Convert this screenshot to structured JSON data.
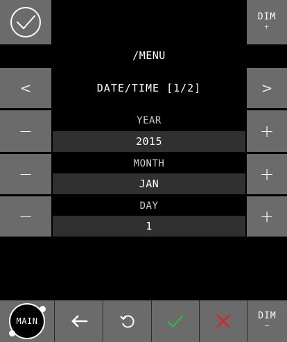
{
  "header": {
    "top_right": {
      "label": "DIM",
      "sign": "+"
    },
    "menu_path": "/MENU"
  },
  "nav": {
    "page_title": "DATE/TIME [1/2]",
    "prev_glyph": "<",
    "next_glyph": ">"
  },
  "fields": [
    {
      "label": "YEAR",
      "value": "2015"
    },
    {
      "label": "MONTH",
      "value": "JAN"
    },
    {
      "label": "DAY",
      "value": "1"
    }
  ],
  "steppers": {
    "minus": "−",
    "plus": "+"
  },
  "bottom_bar": {
    "main_label": "MAIN",
    "dim": {
      "label": "DIM",
      "sign": "−"
    }
  },
  "colors": {
    "background": "#000000",
    "button": "#6b6b6b",
    "field": "#303030",
    "confirm": "#2fbf3a",
    "cancel": "#e0202a"
  },
  "icons": {
    "top_left": "check-circle-icon",
    "back": "back-arrow-icon",
    "undo": "undo-icon",
    "confirm": "checkmark-icon",
    "cancel": "x-icon"
  }
}
